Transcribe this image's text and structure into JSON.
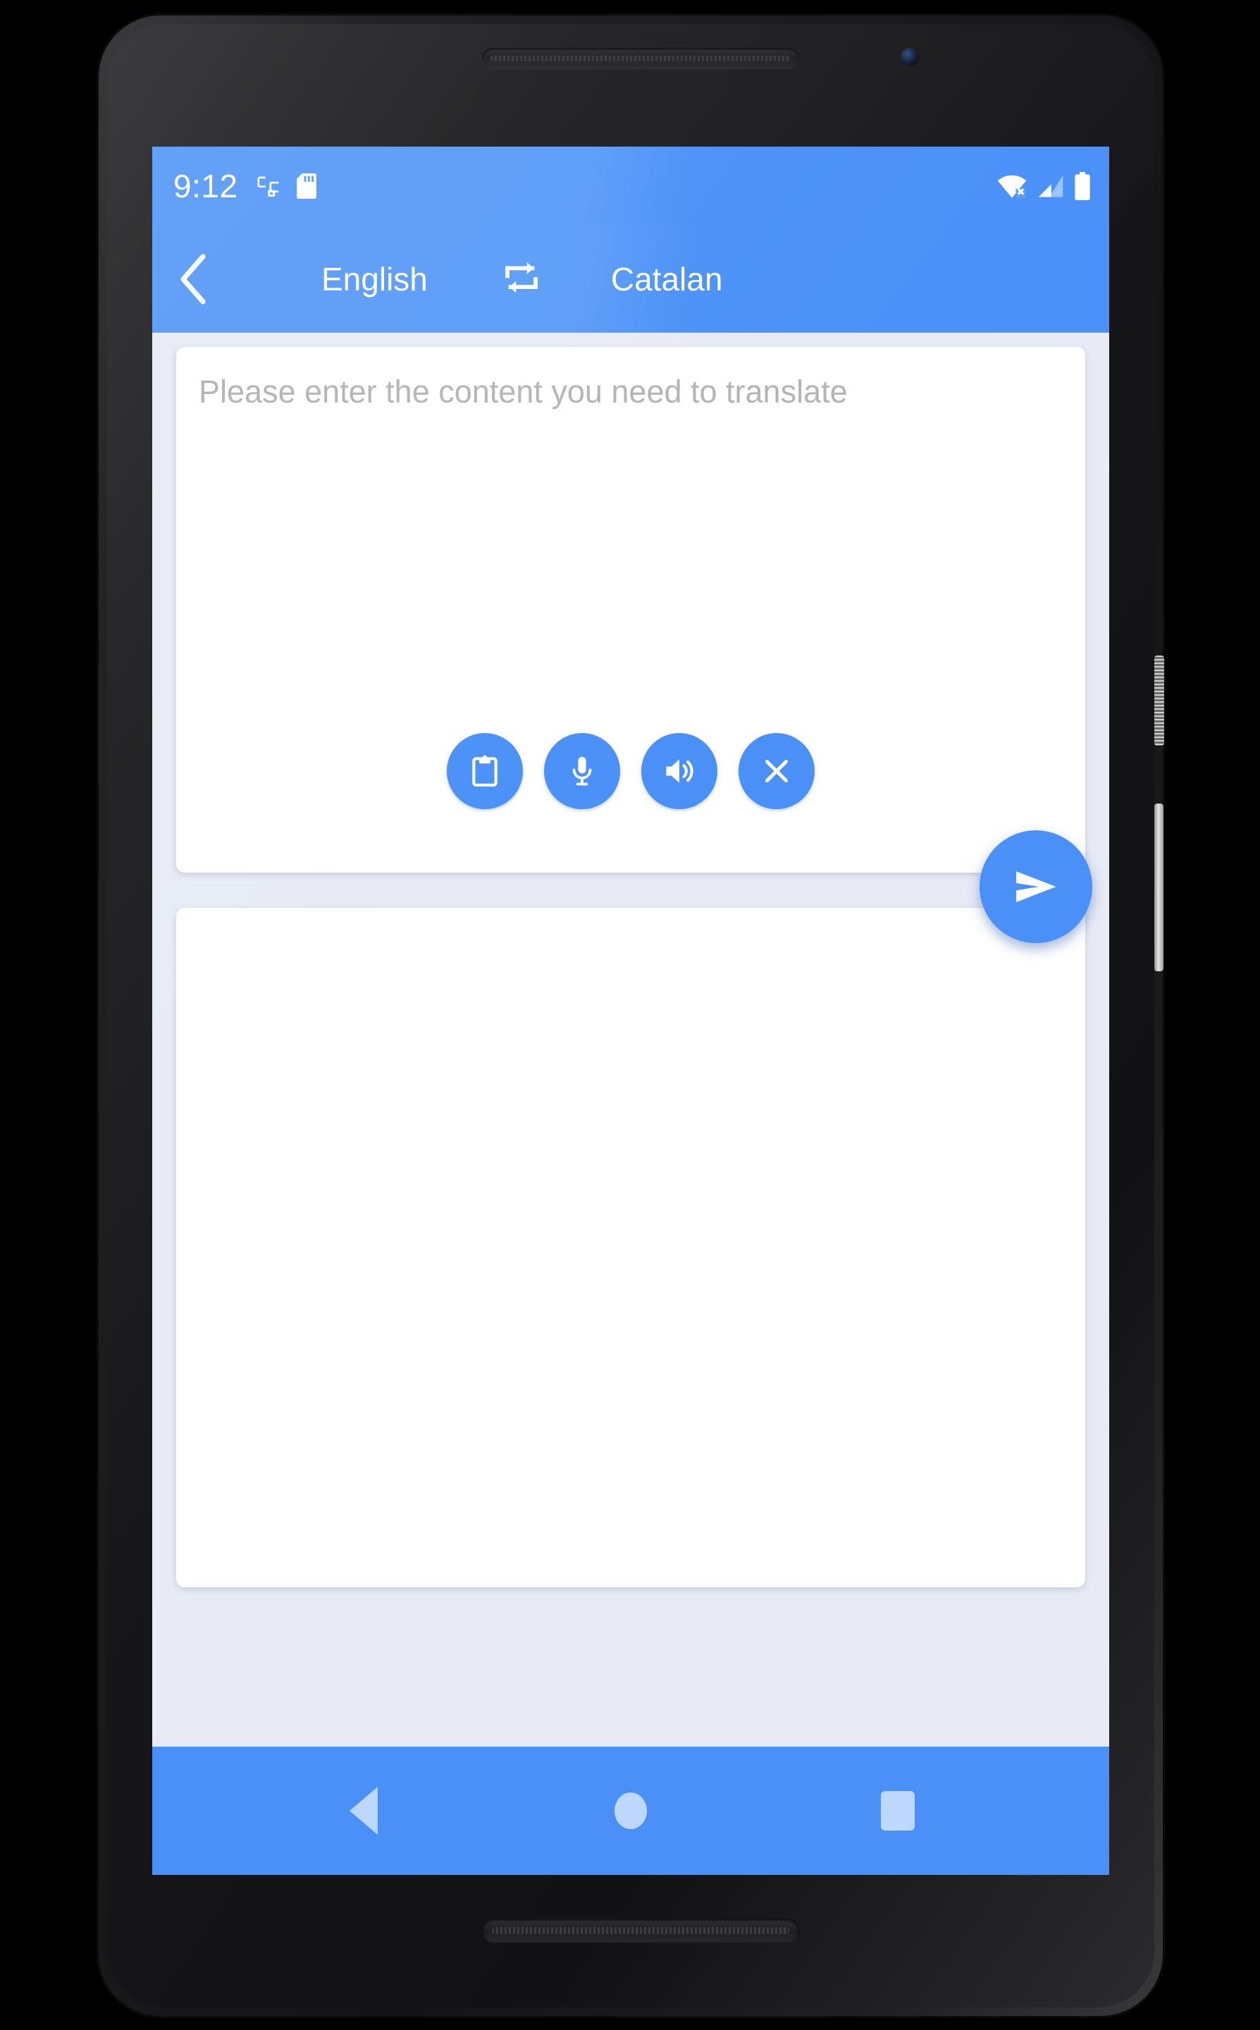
{
  "device": {
    "earpiece_icon": "earpiece-speaker",
    "camera_icon": "front-camera-icon",
    "bottom_speaker_icon": "bottom-speaker",
    "power_button": "power-button",
    "volume_rocker": "volume-rocker"
  },
  "status_bar": {
    "time": "9:12",
    "left_icons": [
      {
        "name": "screen-cast-icon"
      },
      {
        "name": "sd-card-icon"
      }
    ],
    "right_icons": [
      {
        "name": "wifi-disconnected-icon"
      },
      {
        "name": "cellular-signal-icon"
      },
      {
        "name": "battery-full-icon"
      }
    ],
    "background_color": "#4a90f7"
  },
  "app_bar": {
    "back_icon": "back-chevron-icon",
    "source_language": "English",
    "swap_icon": "swap-languages-icon",
    "target_language": "Catalan",
    "background_color": "#4a90f7"
  },
  "source_card": {
    "input_value": "",
    "input_placeholder": "Please enter the content you need to translate",
    "actions": [
      {
        "name": "paste-clipboard-button",
        "icon": "clipboard-icon"
      },
      {
        "name": "voice-input-button",
        "icon": "microphone-icon"
      },
      {
        "name": "speak-text-button",
        "icon": "speaker-icon"
      },
      {
        "name": "clear-text-button",
        "icon": "close-x-icon"
      }
    ]
  },
  "result_card": {
    "result_text": ""
  },
  "send_button": {
    "name": "send-translate-button",
    "icon": "send-paper-plane-icon"
  },
  "nav_bar": {
    "buttons": [
      {
        "name": "nav-back-button",
        "icon": "triangle-back-icon"
      },
      {
        "name": "nav-home-button",
        "icon": "circle-home-icon"
      },
      {
        "name": "nav-recents-button",
        "icon": "square-recents-icon"
      }
    ],
    "background_color": "#4a90f7",
    "icon_color": "#bed8fd"
  },
  "theme": {
    "accent": "#4a90f7",
    "accent_light": "#5b9cf8",
    "page_background": "#e8ebf5",
    "card_background": "#ffffff",
    "placeholder_color": "#b3b3b3"
  }
}
